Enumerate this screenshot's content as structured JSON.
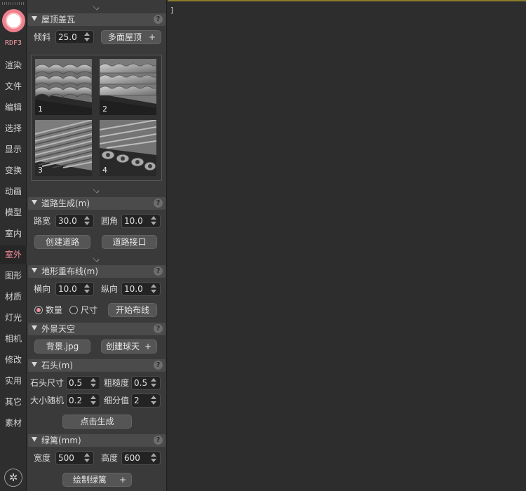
{
  "nav": {
    "rdf_label": "RDF3",
    "items": [
      {
        "label": "渲染"
      },
      {
        "label": "文件"
      },
      {
        "label": "编辑"
      },
      {
        "label": "选择"
      },
      {
        "label": "显示"
      },
      {
        "label": "变换"
      },
      {
        "label": "动画"
      },
      {
        "label": "模型"
      },
      {
        "label": "室内"
      },
      {
        "label": "室外",
        "active": true
      },
      {
        "label": "图形"
      },
      {
        "label": "材质"
      },
      {
        "label": "灯光"
      },
      {
        "label": "相机"
      },
      {
        "label": "修改"
      },
      {
        "label": "实用"
      },
      {
        "label": "其它"
      },
      {
        "label": "素材"
      }
    ],
    "accent_color": "#f08a98"
  },
  "roof": {
    "title": "屋顶盖瓦",
    "help": "?",
    "tilt_label": "倾斜",
    "tilt_value": "25.0",
    "multi_button": "多面屋顶",
    "multi_plus": "+",
    "tiles": [
      "1",
      "2",
      "3",
      "4"
    ]
  },
  "road": {
    "title": "道路生成(m)",
    "help": "?",
    "width_label": "路宽",
    "width_value": "30.0",
    "corner_label": "圆角",
    "corner_value": "10.0",
    "create_button": "创建道路",
    "junction_button": "道路接口"
  },
  "terrain": {
    "title": "地形重布线(m)",
    "help": "?",
    "horizontal_label": "横向",
    "horizontal_value": "10.0",
    "vertical_label": "纵向",
    "vertical_value": "10.0",
    "radio_count": "数量",
    "radio_size": "尺寸",
    "selected": "数量",
    "start_button": "开始布线"
  },
  "sky": {
    "title": "外景天空",
    "help": "?",
    "bg_button": "背景.jpg",
    "dome_button": "创建球天",
    "dome_plus": "+"
  },
  "stone": {
    "title": "石头(m)",
    "help": "?",
    "size_label": "石头尺寸",
    "size_value": "0.5",
    "rough_label": "粗糙度",
    "rough_value": "0.5",
    "random_label": "大小随机",
    "random_value": "0.2",
    "subdiv_label": "细分值",
    "subdiv_value": "2",
    "generate_button": "点击生成"
  },
  "hedge": {
    "title": "绿篱(mm)",
    "help": "?",
    "width_label": "宽度",
    "width_value": "500",
    "height_label": "高度",
    "height_value": "600",
    "draw_button": "绘制绿篱",
    "draw_plus": "+"
  },
  "viewport": {
    "cursor_text": "]"
  }
}
